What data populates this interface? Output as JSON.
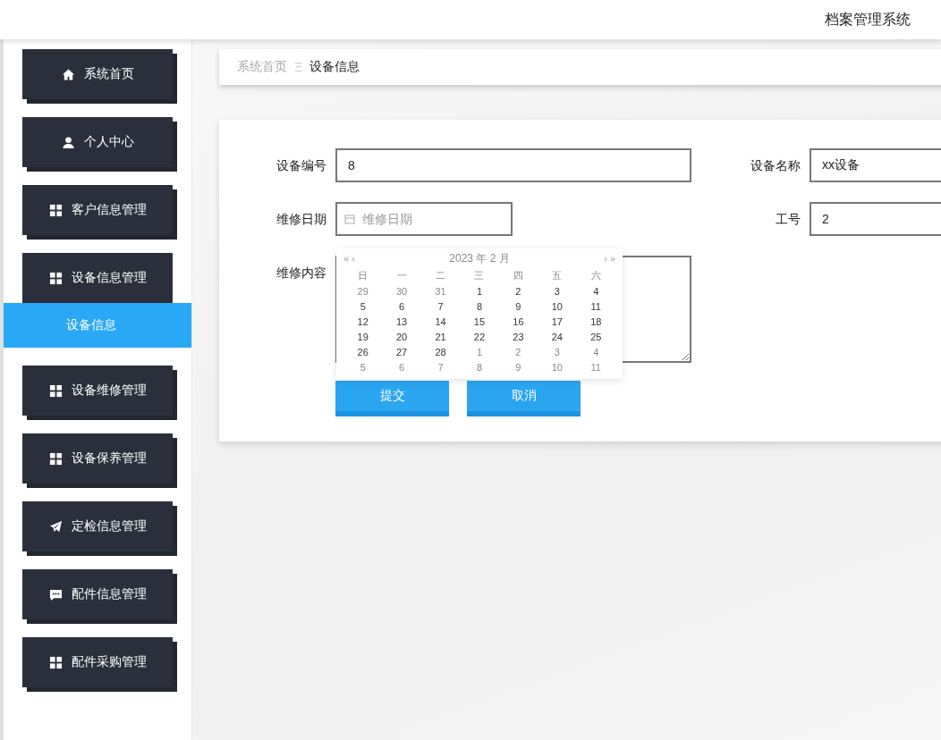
{
  "header": {
    "title": "档案管理系统"
  },
  "sidebar": {
    "items": [
      {
        "label": "系统首页",
        "kind": "home",
        "expanded": false
      },
      {
        "label": "个人中心",
        "kind": "user",
        "expanded": false
      },
      {
        "label": "客户信息管理",
        "kind": "grid",
        "expanded": false
      },
      {
        "label": "设备信息管理",
        "kind": "grid",
        "expanded": true,
        "children": [
          {
            "label": "设备信息",
            "selected": true
          }
        ]
      },
      {
        "label": "设备维修管理",
        "kind": "grid",
        "expanded": false
      },
      {
        "label": "设备保养管理",
        "kind": "grid",
        "expanded": false
      },
      {
        "label": "定检信息管理",
        "kind": "send",
        "expanded": false
      },
      {
        "label": "配件信息管理",
        "kind": "chat",
        "expanded": false
      },
      {
        "label": "配件采购管理",
        "kind": "grid",
        "expanded": false
      }
    ]
  },
  "breadcrumb": {
    "home": "系统首页",
    "separator": "Ξ",
    "current": "设备信息"
  },
  "form": {
    "fields": [
      {
        "label": "设备编号",
        "kind": "text",
        "value": "8"
      },
      {
        "label": "设备名称",
        "kind": "text",
        "value": "xx设备"
      },
      {
        "label": "维修日期",
        "kind": "date",
        "placeholder": "维修日期"
      },
      {
        "label": "工号",
        "kind": "text",
        "value": "2"
      },
      {
        "label": "维修内容",
        "kind": "textarea"
      }
    ],
    "buttons": [
      "提交",
      "取消"
    ]
  },
  "datepicker": {
    "prev": "« ‹",
    "title": "2023 年 2 月",
    "next": "› »",
    "weekdays": [
      "日",
      "一",
      "二",
      "三",
      "四",
      "五",
      "六"
    ],
    "weeks": [
      [
        {
          "day": "29",
          "other": true
        },
        {
          "day": "30",
          "other": true
        },
        {
          "day": "31",
          "other": true
        },
        {
          "day": "1",
          "other": false
        },
        {
          "day": "2",
          "other": false
        },
        {
          "day": "3",
          "other": false
        },
        {
          "day": "4",
          "other": false
        }
      ],
      [
        {
          "day": "5",
          "other": false
        },
        {
          "day": "6",
          "other": false
        },
        {
          "day": "7",
          "other": false
        },
        {
          "day": "8",
          "other": false
        },
        {
          "day": "9",
          "other": false
        },
        {
          "day": "10",
          "other": false
        },
        {
          "day": "11",
          "other": false
        }
      ],
      [
        {
          "day": "12",
          "other": false
        },
        {
          "day": "13",
          "other": false
        },
        {
          "day": "14",
          "other": false
        },
        {
          "day": "15",
          "other": false
        },
        {
          "day": "16",
          "other": false
        },
        {
          "day": "17",
          "other": false
        },
        {
          "day": "18",
          "other": false
        }
      ],
      [
        {
          "day": "19",
          "other": false
        },
        {
          "day": "20",
          "other": false
        },
        {
          "day": "21",
          "other": false
        },
        {
          "day": "22",
          "other": false
        },
        {
          "day": "23",
          "other": false
        },
        {
          "day": "24",
          "other": false
        },
        {
          "day": "25",
          "other": false
        }
      ],
      [
        {
          "day": "26",
          "other": false
        },
        {
          "day": "27",
          "other": false
        },
        {
          "day": "28",
          "other": false
        },
        {
          "day": "1",
          "other": true
        },
        {
          "day": "2",
          "other": true
        },
        {
          "day": "3",
          "other": true
        },
        {
          "day": "4",
          "other": true
        }
      ],
      [
        {
          "day": "5",
          "other": true
        },
        {
          "day": "6",
          "other": true
        },
        {
          "day": "7",
          "other": true
        },
        {
          "day": "8",
          "other": true
        },
        {
          "day": "9",
          "other": true
        },
        {
          "day": "10",
          "other": true
        },
        {
          "day": "11",
          "other": true
        }
      ]
    ]
  }
}
